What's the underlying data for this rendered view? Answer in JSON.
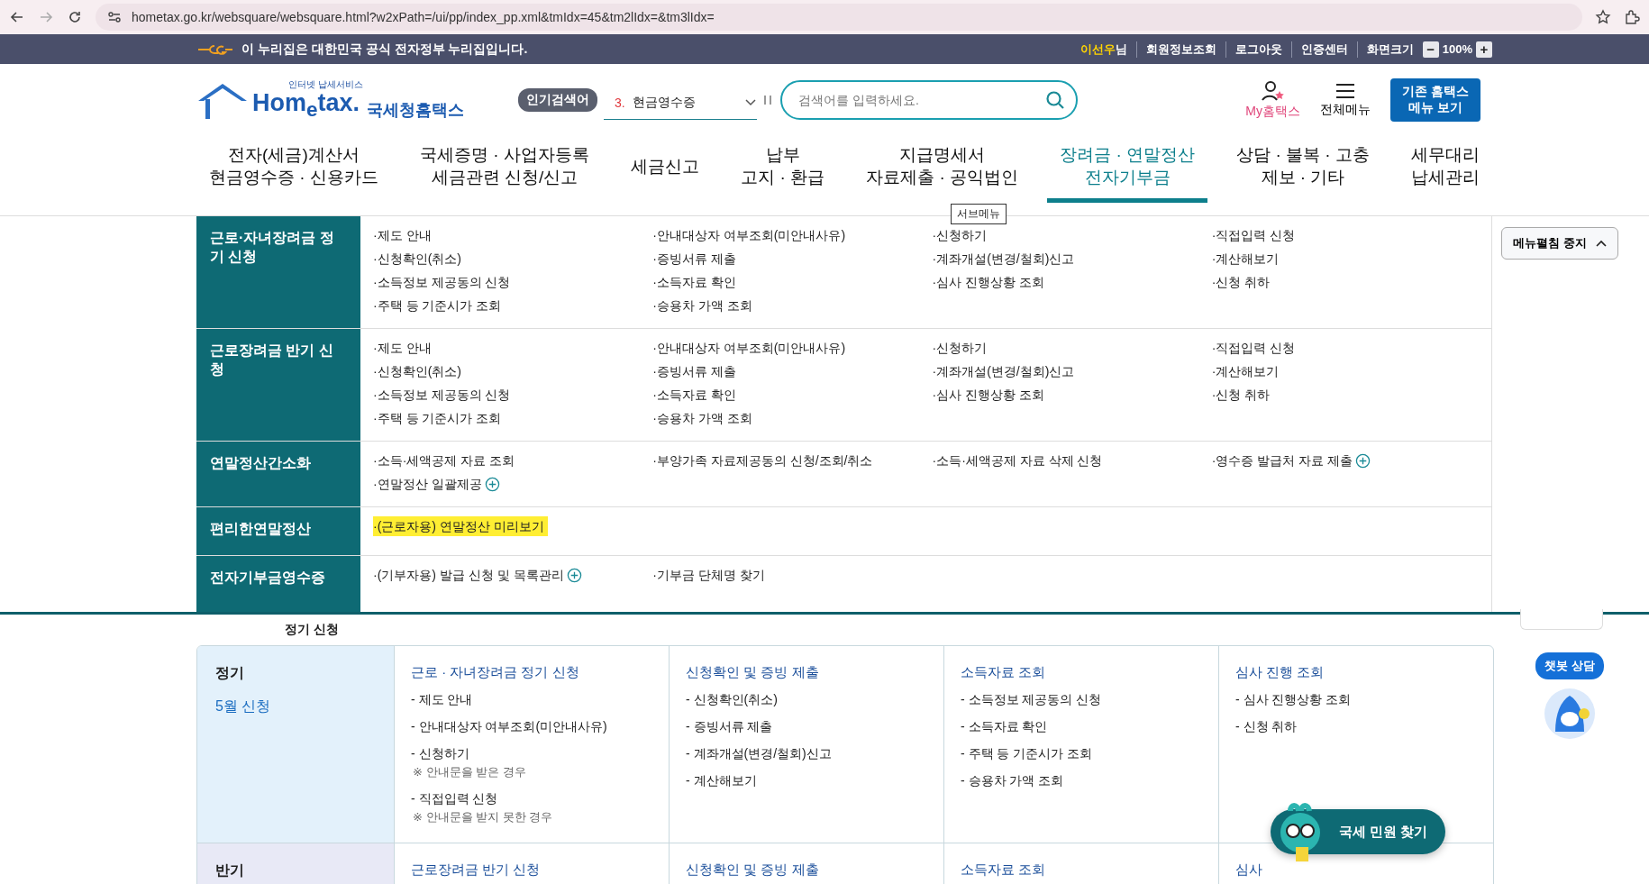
{
  "browser": {
    "url": "hometax.go.kr/websquare/websquare.html?w2xPath=/ui/pp/index_pp.xml&tmIdx=45&tm2lIdx=&tm3lIdx="
  },
  "gov_banner": {
    "text": "이 누리집은 대한민국 공식 전자정부 누리집입니다.",
    "user_name": "이선우",
    "user_suffix": "님",
    "links": [
      "회원정보조회",
      "로그아웃",
      "인증센터"
    ],
    "zoom_label": "화면크기",
    "zoom_out": "−",
    "zoom_value": "100%",
    "zoom_in": "+"
  },
  "header": {
    "logo_small": "인터넷 납세서비스",
    "logo_main": "Hom$_{e}$tax.",
    "logo_suffix": "국세청홈택스",
    "popular": {
      "badge": "인기검색어",
      "rank": "3.",
      "term": "현금영수증"
    },
    "search": {
      "placeholder": "검색어를 입력하세요."
    },
    "my_label": "My홈택스",
    "all_menu_label": "전체메뉴",
    "classic_button": [
      "기존 홈택스",
      "메뉴 보기"
    ]
  },
  "nav": [
    {
      "lines": [
        "전자(세금)계산서",
        "현금영수증 · 신용카드"
      ],
      "selected": false
    },
    {
      "lines": [
        "국세증명 · 사업자등록",
        "세금관련 신청/신고"
      ],
      "selected": false
    },
    {
      "lines": [
        "세금신고"
      ],
      "selected": false
    },
    {
      "lines": [
        "납부",
        "고지 · 환급"
      ],
      "selected": false
    },
    {
      "lines": [
        "지급명세서",
        "자료제출 · 공익법인"
      ],
      "selected": false
    },
    {
      "lines": [
        "장려금 · 연말정산",
        "전자기부금"
      ],
      "selected": true
    },
    {
      "lines": [
        "상담 · 불복 · 고충",
        "제보 · 기타"
      ],
      "selected": false
    },
    {
      "lines": [
        "세무대리",
        "납세관리"
      ],
      "selected": false
    }
  ],
  "tooltip": "서브메뉴",
  "mega_menu": {
    "collapse_button": "메뉴펼침 중지",
    "sections": [
      {
        "title": "근로·자녀장려금 정기 신청",
        "items": [
          {
            "label": "·제도 안내",
            "plus": false,
            "highlighted": false
          },
          {
            "label": "·안내대상자 여부조회(미안내사유)",
            "plus": false,
            "highlighted": false
          },
          {
            "label": "·신청하기",
            "plus": false,
            "highlighted": false
          },
          {
            "label": "·직접입력 신청",
            "plus": false,
            "highlighted": false
          },
          {
            "label": "·신청확인(취소)",
            "plus": false,
            "highlighted": false
          },
          {
            "label": "·증빙서류 제출",
            "plus": false,
            "highlighted": false
          },
          {
            "label": "·계좌개설(변경/철회)신고",
            "plus": false,
            "highlighted": false
          },
          {
            "label": "·계산해보기",
            "plus": false,
            "highlighted": false
          },
          {
            "label": "·소득정보 제공동의 신청",
            "plus": false,
            "highlighted": false
          },
          {
            "label": "·소득자료 확인",
            "plus": false,
            "highlighted": false
          },
          {
            "label": "·심사 진행상황 조회",
            "plus": false,
            "highlighted": false
          },
          {
            "label": "·신청 취하",
            "plus": false,
            "highlighted": false
          },
          {
            "label": "·주택 등 기준시가 조회",
            "plus": false,
            "highlighted": false
          },
          {
            "label": "·승용차 가액 조회",
            "plus": false,
            "highlighted": false
          }
        ]
      },
      {
        "title": "근로장려금 반기 신청",
        "items": [
          {
            "label": "·제도 안내",
            "plus": false,
            "highlighted": false
          },
          {
            "label": "·안내대상자 여부조회(미안내사유)",
            "plus": false,
            "highlighted": false
          },
          {
            "label": "·신청하기",
            "plus": false,
            "highlighted": false
          },
          {
            "label": "·직접입력 신청",
            "plus": false,
            "highlighted": false
          },
          {
            "label": "·신청확인(취소)",
            "plus": false,
            "highlighted": false
          },
          {
            "label": "·증빙서류 제출",
            "plus": false,
            "highlighted": false
          },
          {
            "label": "·계좌개설(변경/철회)신고",
            "plus": false,
            "highlighted": false
          },
          {
            "label": "·계산해보기",
            "plus": false,
            "highlighted": false
          },
          {
            "label": "·소득정보 제공동의 신청",
            "plus": false,
            "highlighted": false
          },
          {
            "label": "·소득자료 확인",
            "plus": false,
            "highlighted": false
          },
          {
            "label": "·심사 진행상황 조회",
            "plus": false,
            "highlighted": false
          },
          {
            "label": "·신청 취하",
            "plus": false,
            "highlighted": false
          },
          {
            "label": "·주택 등 기준시가 조회",
            "plus": false,
            "highlighted": false
          },
          {
            "label": "·승용차 가액 조회",
            "plus": false,
            "highlighted": false
          }
        ]
      },
      {
        "title": "연말정산간소화",
        "items": [
          {
            "label": "·소득·세액공제 자료 조회",
            "plus": false,
            "highlighted": false
          },
          {
            "label": "·부양가족 자료제공동의 신청/조회/취소",
            "plus": false,
            "highlighted": false
          },
          {
            "label": "·소득·세액공제 자료 삭제 신청",
            "plus": false,
            "highlighted": false
          },
          {
            "label": "·영수증 발급처 자료 제출",
            "plus": true,
            "highlighted": false
          },
          {
            "label": "·연말정산 일괄제공",
            "plus": true,
            "highlighted": false
          }
        ]
      },
      {
        "title": "편리한연말정산",
        "items": [
          {
            "label": "·(근로자용) 연말정산 미리보기",
            "plus": false,
            "highlighted": true
          }
        ]
      },
      {
        "title": "전자기부금영수증",
        "items": [
          {
            "label": "·(기부자용) 발급 신청 및 목록관리",
            "plus": true,
            "highlighted": false
          },
          {
            "label": "·기부금 단체명 찾기",
            "plus": false,
            "highlighted": false
          }
        ]
      }
    ]
  },
  "section_label": "정기 신청",
  "table": {
    "rows": [
      {
        "title": "정기",
        "subtitle": "5월 신청",
        "color": "#e3f1fb",
        "cells": [
          {
            "heading": "근로 · 자녀장려금 정기 신청",
            "items": [
              {
                "label": "- 제도 안내"
              },
              {
                "label": "- 안내대상자 여부조회(미안내사유)"
              },
              {
                "label": "- 신청하기",
                "note": "※ 안내문을 받은 경우"
              },
              {
                "label": "- 직접입력 신청",
                "note": "※ 안내문을 받지 못한 경우"
              }
            ]
          },
          {
            "heading": "신청확인 및 증빙 제출",
            "items": [
              {
                "label": "- 신청확인(취소)"
              },
              {
                "label": "- 증빙서류 제출"
              },
              {
                "label": "- 계좌개설(변경/철회)신고"
              },
              {
                "label": "- 계산해보기"
              }
            ]
          },
          {
            "heading": "소득자료 조회",
            "items": [
              {
                "label": "- 소득정보 제공동의 신청"
              },
              {
                "label": "- 소득자료 확인"
              },
              {
                "label": "- 주택 등 기준시가 조회"
              },
              {
                "label": "- 승용차 가액 조회"
              }
            ]
          },
          {
            "heading": "심사 진행 조회",
            "items": [
              {
                "label": "- 심사 진행상황 조회"
              },
              {
                "label": "- 신청 취하"
              }
            ]
          }
        ]
      },
      {
        "title": "반기",
        "color": "#e8e9f6",
        "cells": [
          {
            "heading": "근로장려금 반기 신청"
          },
          {
            "heading": "신청확인 및 증빙 제출"
          },
          {
            "heading": "소득자료 조회"
          },
          {
            "heading": "심사"
          }
        ]
      }
    ]
  },
  "floating": {
    "chatbot": "챗봇 상담",
    "find_button": "국세 민원 찾기"
  }
}
